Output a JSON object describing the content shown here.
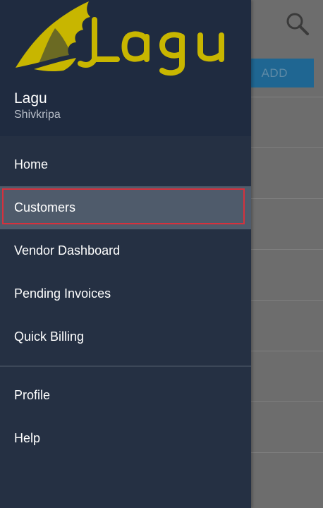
{
  "background": {
    "add_button_label": "ADD",
    "search_icon": "search-icon"
  },
  "drawer": {
    "logo_text": "Lagu",
    "user_name": "Lagu",
    "user_org": "Shivkripa",
    "menu_primary": [
      {
        "label": "Home",
        "selected": false
      },
      {
        "label": "Customers",
        "selected": true
      },
      {
        "label": "Vendor Dashboard",
        "selected": false
      },
      {
        "label": "Pending Invoices",
        "selected": false
      },
      {
        "label": "Quick Billing",
        "selected": false
      }
    ],
    "menu_secondary": [
      {
        "label": "Profile"
      },
      {
        "label": "Help"
      }
    ]
  },
  "colors": {
    "drawer_bg": "#253043",
    "header_bg": "#1f2b40",
    "logo_yellow": "#c8b600",
    "selected_bg": "#4f5b6b",
    "selected_outline": "#d6313d",
    "add_button": "#1f6692"
  }
}
